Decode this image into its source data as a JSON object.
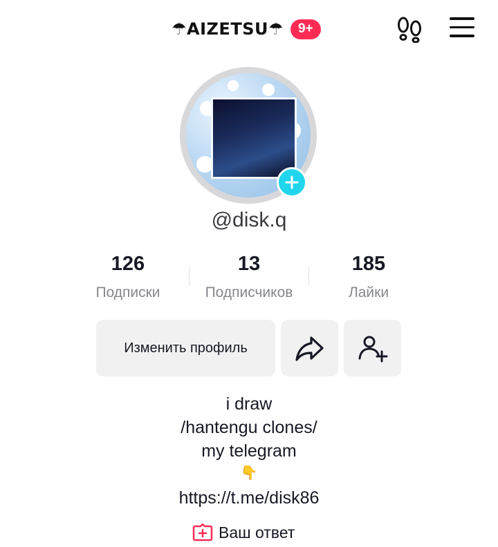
{
  "header": {
    "title": "☂AIZETSU☂",
    "badge": "9+",
    "icons": [
      "footprints-icon",
      "menu-icon"
    ]
  },
  "profile": {
    "username": "@disk.q",
    "stats": [
      {
        "value": "126",
        "label": "Подписки"
      },
      {
        "value": "13",
        "label": "Подписчиков"
      },
      {
        "value": "185",
        "label": "Лайки"
      }
    ]
  },
  "actions": {
    "edit_label": "Изменить профиль",
    "share_icon": "share-arrow-icon",
    "add_friend_icon": "add-friend-icon"
  },
  "bio": {
    "lines": [
      "i draw",
      "/hantengu clones/",
      "my telegram",
      "👇",
      "https://t.me/disk86"
    ]
  },
  "reply": {
    "label": "Ваш ответ",
    "icon": "add-reply-icon"
  },
  "colors": {
    "accent": "#fe2c55",
    "avatar_add": "#20d5ec",
    "secondary_text": "#86878b",
    "button_bg": "#f1f1f2"
  }
}
